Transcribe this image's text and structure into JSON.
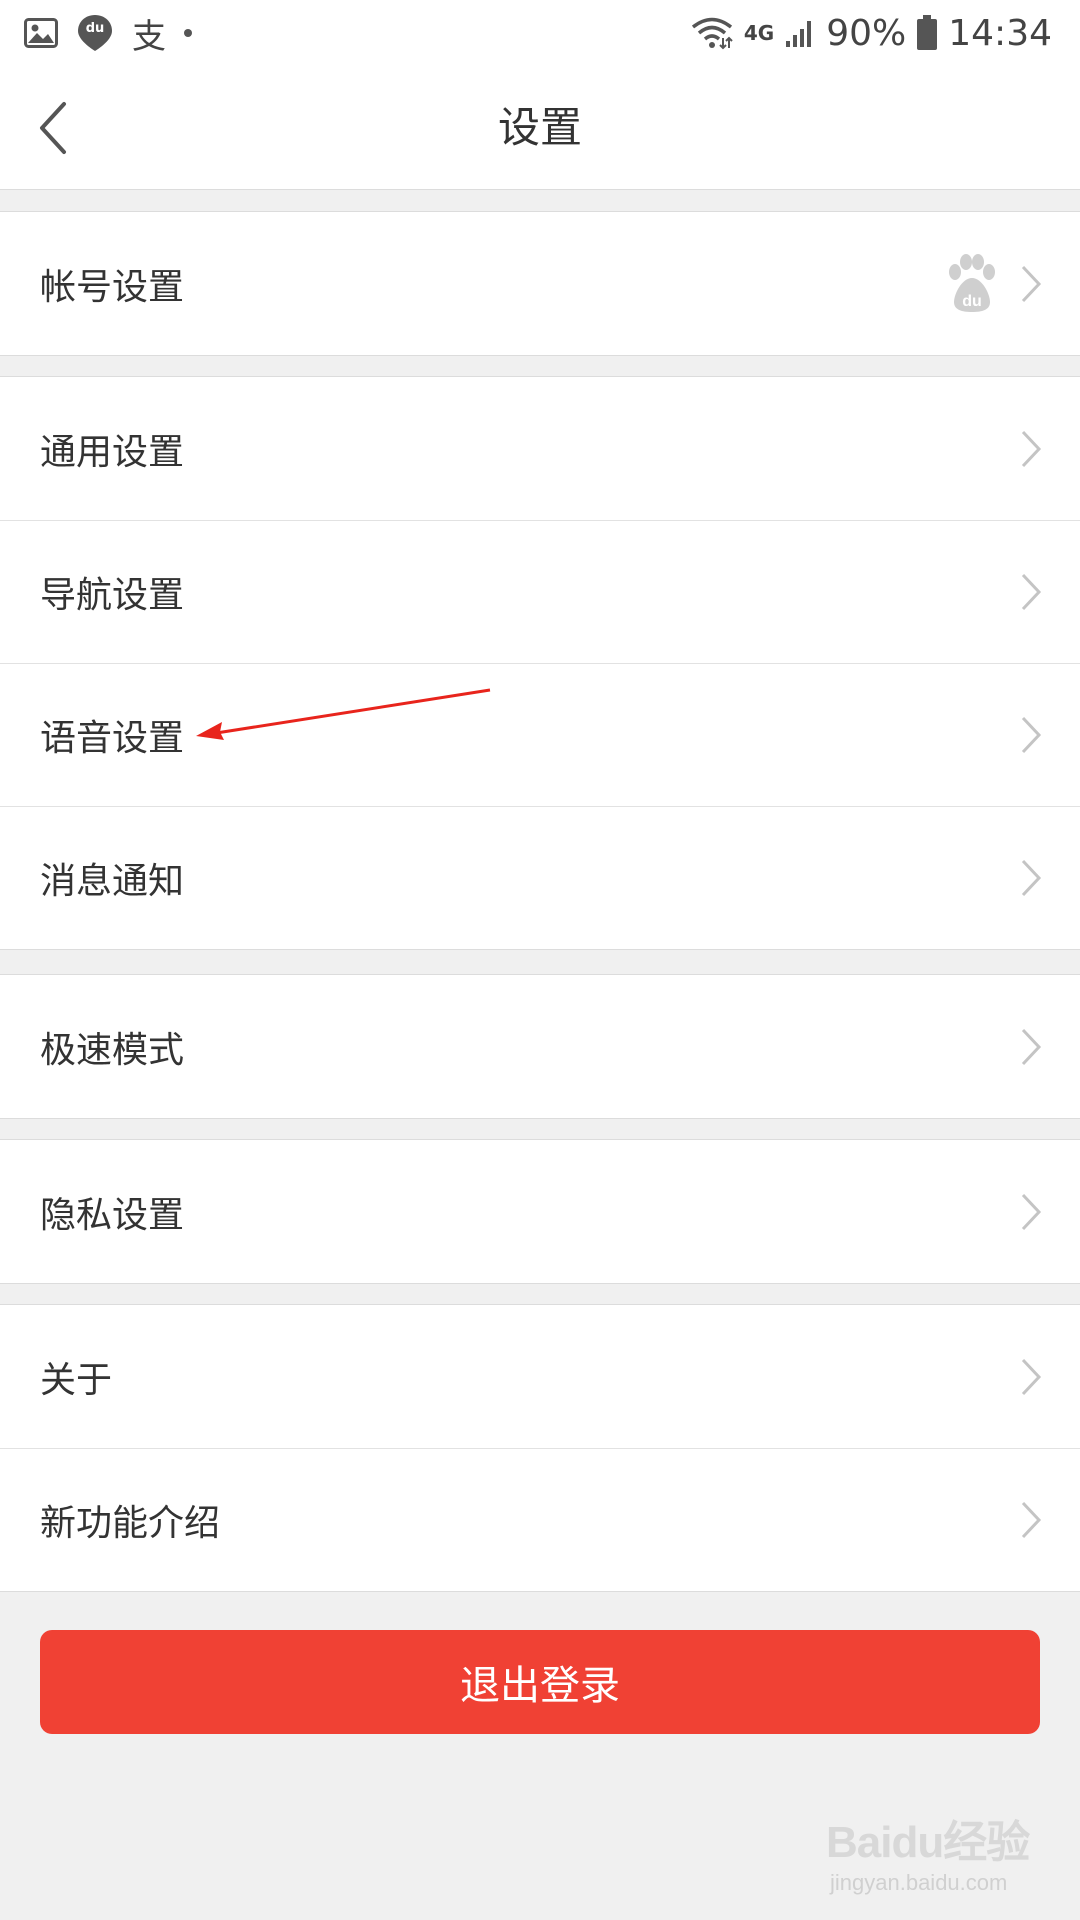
{
  "status_bar": {
    "app_icon_text": "du",
    "alipay_glyph": "支",
    "network": "4G",
    "battery": "90%",
    "time": "14:34",
    "icons": [
      "image-icon",
      "baidu-map-icon",
      "alipay-icon",
      "wifi-icon",
      "signal-icon",
      "battery-icon"
    ]
  },
  "header": {
    "title": "设置",
    "back_icon": "chevron-left-icon"
  },
  "groups": [
    {
      "items": [
        {
          "label": "帐号设置",
          "badge_icon": "baidu-paw-icon"
        }
      ]
    },
    {
      "items": [
        {
          "label": "通用设置"
        },
        {
          "label": "导航设置"
        },
        {
          "label": "语音设置"
        },
        {
          "label": "消息通知"
        }
      ]
    },
    {
      "items": [
        {
          "label": "极速模式"
        }
      ]
    },
    {
      "items": [
        {
          "label": "隐私设置"
        }
      ]
    },
    {
      "items": [
        {
          "label": "关于"
        },
        {
          "label": "新功能介绍"
        }
      ]
    }
  ],
  "logout": {
    "label": "退出登录"
  },
  "watermark": {
    "brand": "Baidu经验",
    "url": "jingyan.baidu.com"
  },
  "colors": {
    "accent": "#f04134",
    "annotation": "#e8241c",
    "text": "#333333",
    "background": "#f0f0f0",
    "chevron": "#c4c4c4"
  }
}
